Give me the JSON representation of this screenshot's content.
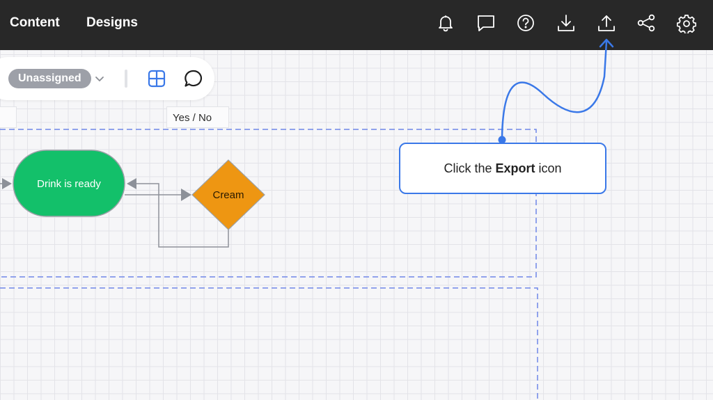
{
  "header": {
    "tabs": [
      {
        "label": "Content"
      },
      {
        "label": "Designs"
      }
    ],
    "icons": [
      "bell-icon",
      "comment-icon",
      "help-icon",
      "download-icon",
      "export-icon",
      "share-icon",
      "gear-icon"
    ]
  },
  "toolbar": {
    "assignee": "Unassigned",
    "icons": [
      "chevron-down-icon",
      "grid-icon",
      "comment-icon"
    ]
  },
  "labels": {
    "left_box": "",
    "yes_no": "Yes / No"
  },
  "diagram": {
    "terminal_label": "Drink is ready",
    "decision_label": "Cream",
    "colors": {
      "terminal_fill": "#13c06a",
      "decision_fill": "#ee9612",
      "connector": "#8d9199",
      "dashed_border": "#6f86e8"
    }
  },
  "callout": {
    "text_before": "Click the ",
    "text_bold": "Export",
    "text_after": " icon",
    "accent": "#3a78e8"
  }
}
